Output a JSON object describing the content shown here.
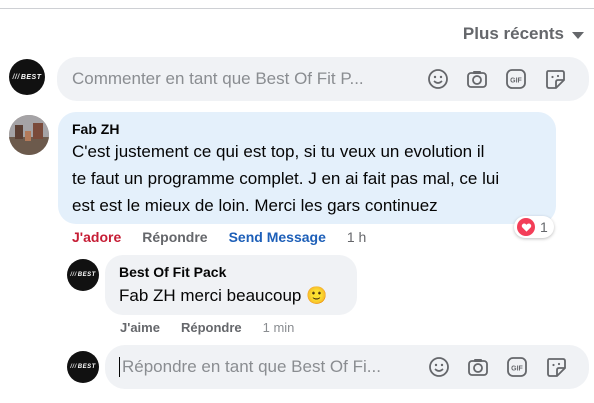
{
  "sort": {
    "label": "Plus récents"
  },
  "top_composer": {
    "placeholder": "Commenter en tant que Best Of Fit P..."
  },
  "page_avatar": {
    "logo_text": "BEST"
  },
  "comment": {
    "author": "Fab ZH",
    "lines": [
      "C'est justement ce qui est top, si tu veux un evolution il",
      "te faut un programme complet. J en ai fait pas mal, ce lui",
      "est est le mieux de loin. Merci les gars continuez"
    ],
    "reaction_count": "1",
    "actions": {
      "like": "J'adore",
      "reply": "Répondre",
      "send_message": "Send Message",
      "time": "1 h"
    }
  },
  "reply": {
    "author": "Best Of Fit Pack",
    "text": "Fab ZH merci beaucoup 🙂",
    "actions": {
      "like": "J'aime",
      "reply": "Répondre",
      "time": "1 min"
    }
  },
  "reply_composer": {
    "placeholder": "Répondre en tant que Best Of Fi..."
  },
  "colors": {
    "like_active": "#c61d35",
    "send_message": "#1d5fb8",
    "bubble_highlight": "#e4f0fb",
    "bubble": "#f0f2f5",
    "heart": "#f33e58"
  },
  "icons": [
    "smiley-icon",
    "camera-icon",
    "gif-icon",
    "sticker-icon",
    "heart-reaction-icon",
    "caret-down-icon"
  ]
}
